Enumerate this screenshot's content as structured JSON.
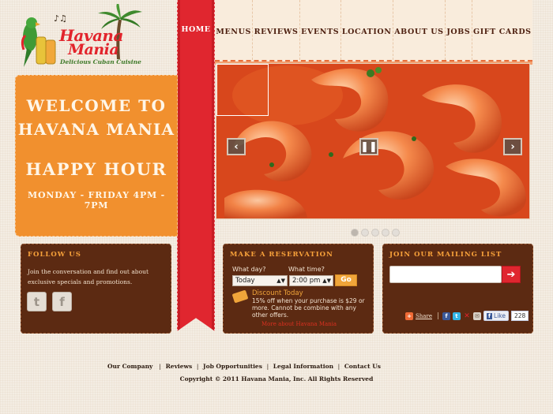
{
  "logo": {
    "line1": "Havana",
    "line2": "Mania",
    "tagline": "Delicious Cuban Cuisine"
  },
  "nav": {
    "home": "HOME",
    "items": [
      "MENUS",
      "REVIEWS",
      "EVENTS",
      "LOCATION",
      "ABOUT US",
      "JOBS",
      "GIFT CARDS"
    ]
  },
  "welcome": {
    "line1": "WELCOME TO",
    "line2": "HAVANA MANIA",
    "line3": "HAPPY HOUR",
    "line4": "MONDAY - FRIDAY 4PM - 7PM"
  },
  "slider": {
    "prev_icon": "chevron-left-icon",
    "pause_icon": "pause-icon",
    "next_icon": "chevron-right-icon",
    "dot_count": 5,
    "active_dot": 1
  },
  "follow": {
    "title": "FOLLOW US",
    "text": "Join the conversation and find out about exclusive specials and promotions."
  },
  "reservation": {
    "title": "MAKE A RESERVATION",
    "day_label": "What day?",
    "day_value": "Today",
    "time_label": "What time?",
    "time_value": "2:00 pm",
    "go_label": "Go",
    "discount_title": "Discount Today",
    "discount_text": "15% off when your purchase is $29 or more. Cannot be combine with any other offers.",
    "more_link": "More about Havana Mania"
  },
  "mailing": {
    "title": "JOIN OUR MAILING LIST",
    "input_value": "",
    "submit_icon": "arrow-right-icon",
    "share_label": "Share",
    "like_label": "Like",
    "like_count": "228"
  },
  "footer": {
    "links": [
      "Our Company",
      "Reviews",
      "Job Opportunities",
      "Legal Information",
      "Contact Us"
    ],
    "copyright": "Copyright © 2011 Havana Mania, Inc. All Rights Reserved"
  },
  "colors": {
    "ribbon_red": "#e0262f",
    "welcome_orange": "#f1902e",
    "panel_brown": "#5c2a12",
    "panel_title": "#f7a13a"
  }
}
